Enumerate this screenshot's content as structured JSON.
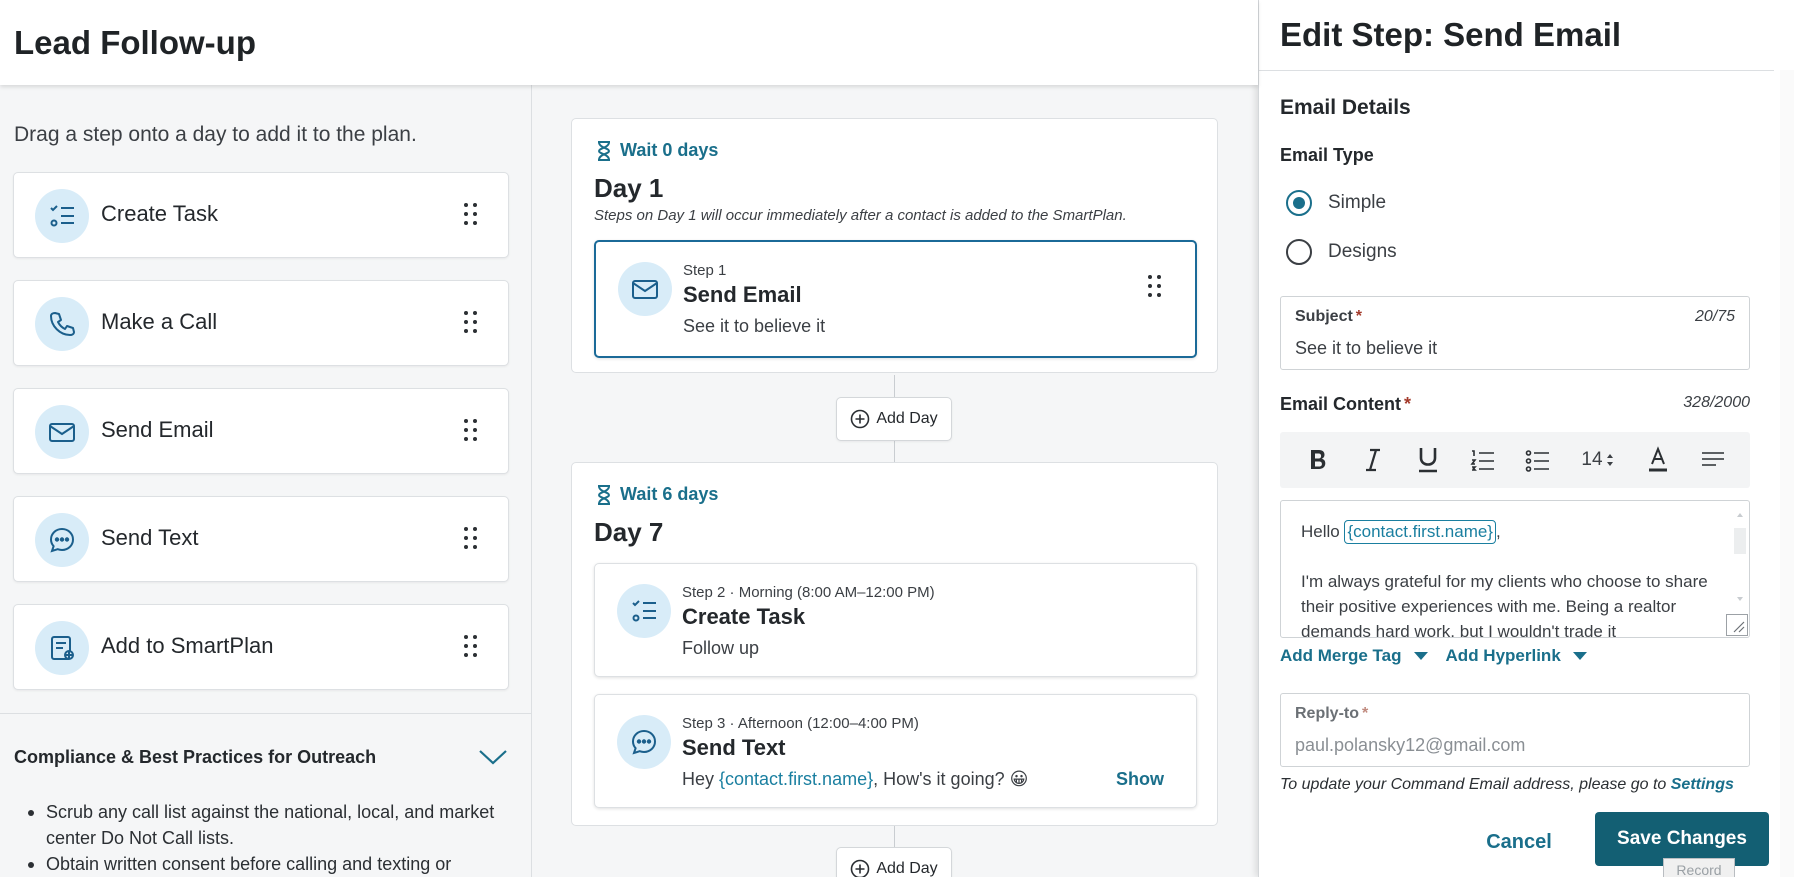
{
  "header": {
    "title": "Lead Follow-up"
  },
  "sidebar": {
    "hint": "Drag a step onto a day to add it to the plan.",
    "items": [
      {
        "label": "Create Task",
        "icon": "task-list-icon"
      },
      {
        "label": "Make a Call",
        "icon": "phone-icon"
      },
      {
        "label": "Send Email",
        "icon": "envelope-icon"
      },
      {
        "label": "Send Text",
        "icon": "chat-bubble-icon"
      },
      {
        "label": "Add to SmartPlan",
        "icon": "smartplan-icon"
      }
    ],
    "compliance": {
      "title": "Compliance & Best Practices for Outreach",
      "bullets": [
        "Scrub any call list against the national, local, and market center Do Not Call lists.",
        "Obtain written consent before calling and texting or"
      ]
    }
  },
  "plan": {
    "days": [
      {
        "wait": "Wait 0 days",
        "title": "Day 1",
        "note": "Steps on Day 1 will occur immediately after a contact is added to the SmartPlan.",
        "steps": [
          {
            "meta": "Step 1",
            "title": "Send Email",
            "desc": "See it to believe it",
            "icon": "envelope-icon"
          }
        ]
      },
      {
        "wait": "Wait 6 days",
        "title": "Day 7",
        "steps": [
          {
            "meta": "Step 2 · Morning (8:00 AM–12:00 PM)",
            "title": "Create Task",
            "desc": "Follow up",
            "icon": "task-list-icon"
          },
          {
            "meta": "Step 3 · Afternoon (12:00–4:00 PM)",
            "title": "Send Text",
            "desc_prefix": "Hey ",
            "desc_merge": "{contact.first.name}",
            "desc_suffix": ", How's it going? 😀",
            "show_label": "Show",
            "icon": "chat-bubble-icon"
          }
        ]
      }
    ],
    "add_day_label": "Add Day"
  },
  "panel": {
    "title": "Edit Step: Send Email",
    "section": "Email Details",
    "email_type": {
      "label": "Email Type",
      "options": [
        "Simple",
        "Designs"
      ],
      "selected": "Simple"
    },
    "subject": {
      "label": "Subject",
      "required_mark": "*",
      "counter": "20/75",
      "value": "See it to believe it"
    },
    "content": {
      "label": "Email Content",
      "required_mark": "*",
      "counter": "328/2000",
      "font_size": "14",
      "greeting": "Hello ",
      "greeting_merge": "{contact.first.name}",
      "greeting_end": ",",
      "body": "I'm always grateful for my clients who choose to share their positive experiences with me. Being a realtor demands hard work, but I wouldn't trade it"
    },
    "add_merge_tag": "Add Merge Tag",
    "add_hyperlink": "Add Hyperlink",
    "reply_to": {
      "label": "Reply-to",
      "required_mark": "*",
      "placeholder": "paul.polansky12@gmail.com"
    },
    "update_note": "To update your Command Email address, please go to ",
    "update_link": "Settings",
    "cancel_label": "Cancel",
    "save_label": "Save Changes",
    "record_label": "Record"
  },
  "colors": {
    "accent": "#1a6f8b",
    "primary_button": "#135f73",
    "icon_bg": "#d8ecf8",
    "selected_border": "#1b6a98"
  }
}
